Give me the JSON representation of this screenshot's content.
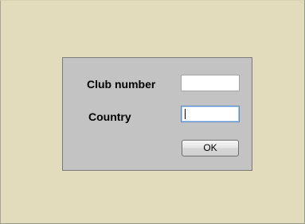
{
  "form": {
    "club_number_label": "Club number",
    "club_number_value": "",
    "country_label": "Country",
    "country_value": "",
    "ok_label": "OK"
  },
  "colors": {
    "window_background": "#e2dcbc",
    "dialog_background": "#c3c3c3",
    "focus_border": "#5a8ec8"
  }
}
